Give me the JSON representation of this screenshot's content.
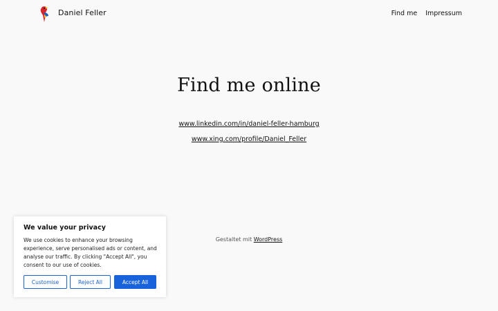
{
  "header": {
    "site_title": "Daniel Feller",
    "logo_icon": "parrot-icon",
    "nav": [
      "Find me",
      "Impressum"
    ]
  },
  "main": {
    "title": "Find me online",
    "links": [
      "www.linkedin.com/in/daniel-feller-hamburg",
      "www.xing.com/profile/Daniel_Feller"
    ]
  },
  "footer": {
    "prefix": "Gestaltet mit",
    "link": "WordPress"
  },
  "cookie_banner": {
    "title": "We value your privacy",
    "text": "We use cookies to enhance your browsing experience, serve personalised ads or content, and analyse our traffic. By clicking \"Accept All\", you consent to our use of cookies.",
    "customise_label": "Customise",
    "reject_label": "Reject All",
    "accept_label": "Accept All",
    "accent_color": "#1863dc"
  }
}
